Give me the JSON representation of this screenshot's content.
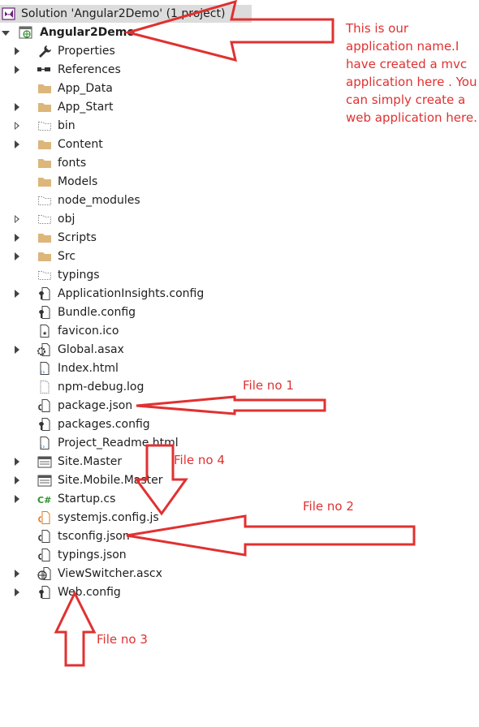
{
  "solution": {
    "label": "Solution 'Angular2Demo' (1 project)"
  },
  "project": {
    "label": "Angular2Demo"
  },
  "items": [
    {
      "label": "Properties",
      "icon": "wrench-icon",
      "expandable": true
    },
    {
      "label": "References",
      "icon": "references-icon",
      "expandable": true
    },
    {
      "label": "App_Data",
      "icon": "folder-icon",
      "expandable": false
    },
    {
      "label": "App_Start",
      "icon": "folder-icon",
      "expandable": true
    },
    {
      "label": "bin",
      "icon": "hidden-folder-icon",
      "expandable": true,
      "hollow": true
    },
    {
      "label": "Content",
      "icon": "folder-icon",
      "expandable": true
    },
    {
      "label": "fonts",
      "icon": "folder-icon",
      "expandable": false
    },
    {
      "label": "Models",
      "icon": "folder-icon",
      "expandable": false
    },
    {
      "label": "node_modules",
      "icon": "hidden-folder-icon",
      "expandable": false
    },
    {
      "label": "obj",
      "icon": "hidden-folder-icon",
      "expandable": true,
      "hollow": true
    },
    {
      "label": "Scripts",
      "icon": "folder-icon",
      "expandable": true
    },
    {
      "label": "Src",
      "icon": "folder-icon",
      "expandable": true
    },
    {
      "label": "typings",
      "icon": "hidden-folder-icon",
      "expandable": false
    },
    {
      "label": "ApplicationInsights.config",
      "icon": "config-file-icon",
      "expandable": true
    },
    {
      "label": "Bundle.config",
      "icon": "config-file-icon",
      "expandable": false
    },
    {
      "label": "favicon.ico",
      "icon": "image-file-icon",
      "expandable": false
    },
    {
      "label": "Global.asax",
      "icon": "gear-file-icon",
      "expandable": true
    },
    {
      "label": "Index.html",
      "icon": "html-file-icon",
      "expandable": false
    },
    {
      "label": "npm-debug.log",
      "icon": "text-file-icon",
      "expandable": false
    },
    {
      "label": "package.json",
      "icon": "json-file-icon",
      "expandable": false
    },
    {
      "label": "packages.config",
      "icon": "config-file-icon",
      "expandable": false
    },
    {
      "label": "Project_Readme.html",
      "icon": "html-file-icon",
      "expandable": false
    },
    {
      "label": "Site.Master",
      "icon": "master-page-icon",
      "expandable": true
    },
    {
      "label": "Site.Mobile.Master",
      "icon": "master-page-icon",
      "expandable": true
    },
    {
      "label": "Startup.cs",
      "icon": "csharp-file-icon",
      "expandable": true
    },
    {
      "label": "systemjs.config.js",
      "icon": "js-file-icon",
      "expandable": false
    },
    {
      "label": "tsconfig.json",
      "icon": "json-file-icon",
      "expandable": false
    },
    {
      "label": "typings.json",
      "icon": "json-file-icon",
      "expandable": false
    },
    {
      "label": "ViewSwitcher.ascx",
      "icon": "web-control-icon",
      "expandable": true
    },
    {
      "label": "Web.config",
      "icon": "config-file-icon",
      "expandable": true
    }
  ],
  "annotations": {
    "app_note": "This is our application name.I have created a mvc application here . You can simply create a web application here.",
    "file1": "File no 1",
    "file2": "File no 2",
    "file3": "File no 3",
    "file4": "File no 4"
  },
  "colors": {
    "annotation": "#e03131",
    "folder": "#dcb67a",
    "header_bg": "#dcdcdc"
  }
}
